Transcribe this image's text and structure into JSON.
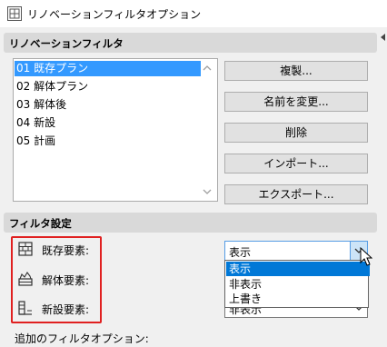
{
  "window": {
    "title": "リノベーションフィルタオプション"
  },
  "sections": {
    "filters": "リノベーションフィルタ",
    "settings": "フィルタ設定"
  },
  "filter_list": {
    "items": [
      {
        "label": "01 既存プラン",
        "selected": true
      },
      {
        "label": "02 解体プラン",
        "selected": false
      },
      {
        "label": "03 解体後",
        "selected": false
      },
      {
        "label": "04 新設",
        "selected": false
      },
      {
        "label": "05 計画",
        "selected": false
      }
    ]
  },
  "buttons": {
    "duplicate": "複製...",
    "rename": "名前を変更...",
    "delete": "削除",
    "import": "インポート...",
    "export": "エクスポート..."
  },
  "elements": [
    {
      "label": "既存要素:",
      "icon": "existing-element-icon",
      "value": "表示"
    },
    {
      "label": "解体要素:",
      "icon": "demolished-element-icon",
      "value": ""
    },
    {
      "label": "新設要素:",
      "icon": "new-element-icon",
      "value": "非表示"
    }
  ],
  "dropdown_options": [
    "表示",
    "非表示",
    "上書き"
  ],
  "additional_options_label": "追加のフィルタオプション:",
  "colors": {
    "selection": "#3399ff",
    "highlight_box": "#e02020",
    "dropdown_highlight": "#0078d7"
  }
}
